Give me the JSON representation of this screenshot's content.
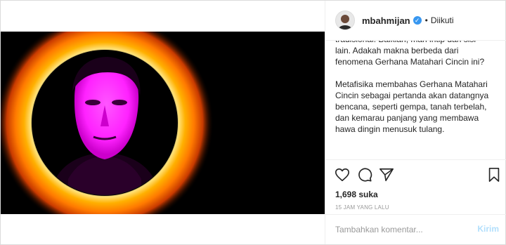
{
  "post": {
    "username": "mbahmijan",
    "verified_icon": "verified-badge-icon",
    "separator": "•",
    "follow_status": "Diikuti",
    "caption": {
      "paragraph_1": "dinilai berbahaya untuk kapal-kapal tradisional. Baiklah, mari intip dari sisi lain. Adakah makna berbeda dari fenomena Gerhana Matahari Cincin ini?",
      "paragraph_2": "Metafisika membahas Gerhana Matahari Cincin sebagai pertanda akan datangnya bencana, seperti gempa, tanah terbelah, dan kemarau panjang yang membawa hawa dingin menusuk tulang."
    },
    "likes": "1,698 suka",
    "timestamp": "15 JAM YANG LALU",
    "comment": {
      "placeholder": "Tambahkan komentar...",
      "submit_label": "Kirim"
    },
    "icons": [
      "heart-icon",
      "comment-icon",
      "share-icon",
      "bookmark-icon"
    ],
    "colors": {
      "accent": "#3897f0",
      "submit_disabled": "#b2dffc",
      "face_tint": "#ff22ff",
      "corona": "#ff8a00"
    }
  }
}
